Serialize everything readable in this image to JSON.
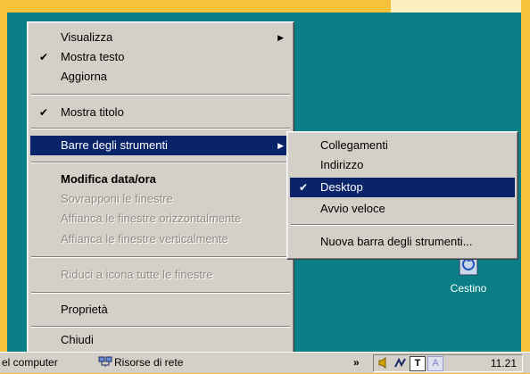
{
  "context_menu": {
    "items": [
      {
        "label": "Visualizza",
        "check": "",
        "submenu": true,
        "state": "normal"
      },
      {
        "label": "Mostra testo",
        "check": "✔",
        "submenu": false,
        "state": "normal"
      },
      {
        "label": "Aggiorna",
        "check": "",
        "submenu": false,
        "state": "normal"
      },
      {
        "label": "Mostra titolo",
        "check": "✔",
        "submenu": false,
        "state": "normal"
      },
      {
        "label": "Barre degli strumenti",
        "check": "",
        "submenu": true,
        "state": "selected"
      },
      {
        "label": "Modifica data/ora",
        "check": "",
        "submenu": false,
        "state": "bold"
      },
      {
        "label": "Sovrapponi le finestre",
        "check": "",
        "submenu": false,
        "state": "disabled"
      },
      {
        "label": "Affianca le finestre orizzontalmente",
        "check": "",
        "submenu": false,
        "state": "disabled"
      },
      {
        "label": "Affianca le finestre verticalmente",
        "check": "",
        "submenu": false,
        "state": "disabled"
      },
      {
        "label": "Riduci a icona tutte le finestre",
        "check": "",
        "submenu": false,
        "state": "disabled"
      },
      {
        "label": "Proprietà",
        "check": "",
        "submenu": false,
        "state": "normal"
      },
      {
        "label": "Chiudi",
        "check": "",
        "submenu": false,
        "state": "normal"
      }
    ]
  },
  "submenu": {
    "items": [
      {
        "label": "Collegamenti",
        "check": "",
        "state": "normal"
      },
      {
        "label": "Indirizzo",
        "check": "",
        "state": "normal"
      },
      {
        "label": "Desktop",
        "check": "✔",
        "state": "selected"
      },
      {
        "label": "Avvio veloce",
        "check": "",
        "state": "normal"
      },
      {
        "label": "Nuova barra degli strumenti...",
        "check": "",
        "state": "normal"
      }
    ]
  },
  "desktop": {
    "recycle_bin_label": "Cestino"
  },
  "taskbar": {
    "item_1": "el computer",
    "item_2": "Risorse di rete",
    "chevron": "»",
    "clock": "11.21"
  },
  "colors": {
    "desktop": "#0a7f86",
    "frame": "#f7c23b",
    "menu": "#d4d0c8",
    "selection": "#0a246a"
  }
}
